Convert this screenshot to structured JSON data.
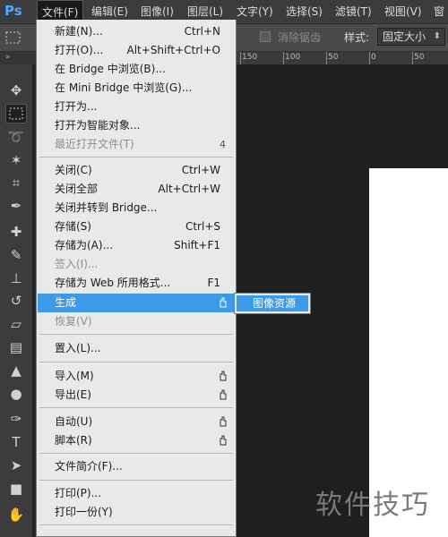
{
  "app": {
    "logo": "Ps"
  },
  "menubar": {
    "items": [
      {
        "label": "文件(F)"
      },
      {
        "label": "编辑(E)"
      },
      {
        "label": "图像(I)"
      },
      {
        "label": "图层(L)"
      },
      {
        "label": "文字(Y)"
      },
      {
        "label": "选择(S)"
      },
      {
        "label": "滤镜(T)"
      },
      {
        "label": "视图(V)"
      },
      {
        "label": "窗"
      }
    ]
  },
  "options_bar": {
    "antialias_label": "消除锯齿",
    "style_label": "样式:",
    "style_value": "固定大小"
  },
  "ruler": {
    "labels": [
      "150",
      "100",
      "50",
      "0",
      "50"
    ]
  },
  "toolbar": {
    "tools": [
      {
        "icon": "move-icon"
      },
      {
        "icon": "rect-marquee-icon"
      },
      {
        "icon": "lasso-icon"
      },
      {
        "icon": "magic-wand-icon"
      },
      {
        "icon": "crop-icon"
      },
      {
        "icon": "eyedropper-icon"
      },
      {
        "icon": "healing-brush-icon"
      },
      {
        "icon": "brush-icon"
      },
      {
        "icon": "clone-stamp-icon"
      },
      {
        "icon": "history-brush-icon"
      },
      {
        "icon": "eraser-icon"
      },
      {
        "icon": "gradient-icon"
      },
      {
        "icon": "blur-icon"
      },
      {
        "icon": "dodge-icon"
      },
      {
        "icon": "pen-icon"
      },
      {
        "icon": "type-icon"
      },
      {
        "icon": "path-selection-icon"
      },
      {
        "icon": "rectangle-shape-icon"
      },
      {
        "icon": "hand-icon"
      }
    ]
  },
  "file_menu": {
    "new": {
      "label": "新建(N)...",
      "shortcut": "Ctrl+N"
    },
    "open": {
      "label": "打开(O)...",
      "shortcut": "Alt+Shift+Ctrl+O"
    },
    "browse_bridge": {
      "label": "在 Bridge 中浏览(B)..."
    },
    "browse_mini_bridge": {
      "label": "在 Mini Bridge 中浏览(G)..."
    },
    "open_as": {
      "label": "打开为..."
    },
    "open_smart": {
      "label": "打开为智能对象..."
    },
    "recent": {
      "label": "最近打开文件(T)",
      "arrow": "4"
    },
    "close": {
      "label": "关闭(C)",
      "shortcut": "Ctrl+W"
    },
    "close_all": {
      "label": "关闭全部",
      "shortcut": "Alt+Ctrl+W"
    },
    "close_to_bridge": {
      "label": "关闭并转到 Bridge..."
    },
    "save": {
      "label": "存储(S)",
      "shortcut": "Ctrl+S"
    },
    "save_as": {
      "label": "存储为(A)...",
      "shortcut": "Shift+F1"
    },
    "check_in": {
      "label": "签入(I)..."
    },
    "save_web": {
      "label": "存储为 Web 所用格式...",
      "shortcut": "F1"
    },
    "generate": {
      "label": "生成"
    },
    "revert": {
      "label": "恢复(V)"
    },
    "place": {
      "label": "置入(L)..."
    },
    "import": {
      "label": "导入(M)"
    },
    "export": {
      "label": "导出(E)"
    },
    "automate": {
      "label": "自动(U)"
    },
    "scripts": {
      "label": "脚本(R)"
    },
    "file_info": {
      "label": "文件简介(F)..."
    },
    "print": {
      "label": "打印(P)..."
    },
    "print_one": {
      "label": "打印一份(Y)"
    }
  },
  "submenu": {
    "image_assets": "图像资源"
  },
  "watermark": "软件技巧"
}
